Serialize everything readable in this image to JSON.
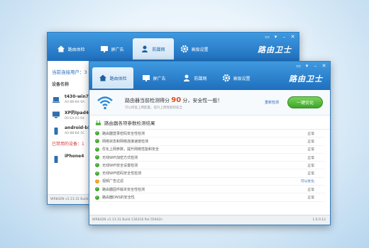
{
  "brand": "路由卫士",
  "tabs": [
    {
      "label": "路由体检",
      "icon": "home-icon"
    },
    {
      "label": "屏广告",
      "icon": "monitor-icon"
    },
    {
      "label": "防蹭网",
      "icon": "user-shield-icon"
    },
    {
      "label": "高级设置",
      "icon": "gear-icon"
    }
  ],
  "back_window": {
    "current_user": "当前连接用户：3",
    "device_header": "设备名称",
    "devices": [
      {
        "name": "t430-win7",
        "mac": "A0-88-B4-0A"
      },
      {
        "name": "XP的Ipad4",
        "mac": "00-EA-01-04"
      },
      {
        "name": "android-b5",
        "mac": "A0-88-B4-5C"
      }
    ],
    "disabled_header": "已禁用的设备：1",
    "disabled_devices": [
      {
        "name": "iPhone4",
        "mac": ""
      }
    ],
    "status_left": "WR842N v1.13.31 Build 130318 Rel.55942n"
  },
  "front_window": {
    "score_prefix": "路由器当前检测得分",
    "score_value": "90",
    "score_suffix": "分，安全性一般！",
    "score_sub": "可以修复上网配置，提升上网性能和安全",
    "recheck_label": "重新检测",
    "optimize_label": "一键优化",
    "section_title": "路由器各项参数检测结果",
    "checks": [
      {
        "label": "路由器登录密码安全性检测",
        "status": "正常",
        "warn": false
      },
      {
        "label": "网络状态和网络连接速度检测",
        "status": "正常",
        "warn": false
      },
      {
        "label": "优化上网参数，提升网络性能和安全",
        "status": "正常",
        "warn": false
      },
      {
        "label": "无线WiFi加密方式检测",
        "status": "正常",
        "warn": false
      },
      {
        "label": "无线WiFi安全设置检测",
        "status": "正常",
        "warn": false
      },
      {
        "label": "无线WiFi密码安全性检测",
        "status": "正常",
        "warn": false
      },
      {
        "label": "视频广告过滤",
        "status": "可以优化",
        "warn": true
      },
      {
        "label": "路由器固件版本安全性检测",
        "status": "正常",
        "warn": false
      },
      {
        "label": "路由器DNS的安全性",
        "status": "正常",
        "warn": false
      }
    ],
    "status_left": "WR842N v1.13.31 Build 130318 Rel.55942n",
    "status_right": "1.0.0.12"
  },
  "colors": {
    "titlebar": "#2a82cf",
    "score": "#e04b1d",
    "ok_dot": "#47a832",
    "warn_dot": "#f0a21e",
    "optimize": "#4fb834",
    "disabled": "#d23b3b"
  }
}
